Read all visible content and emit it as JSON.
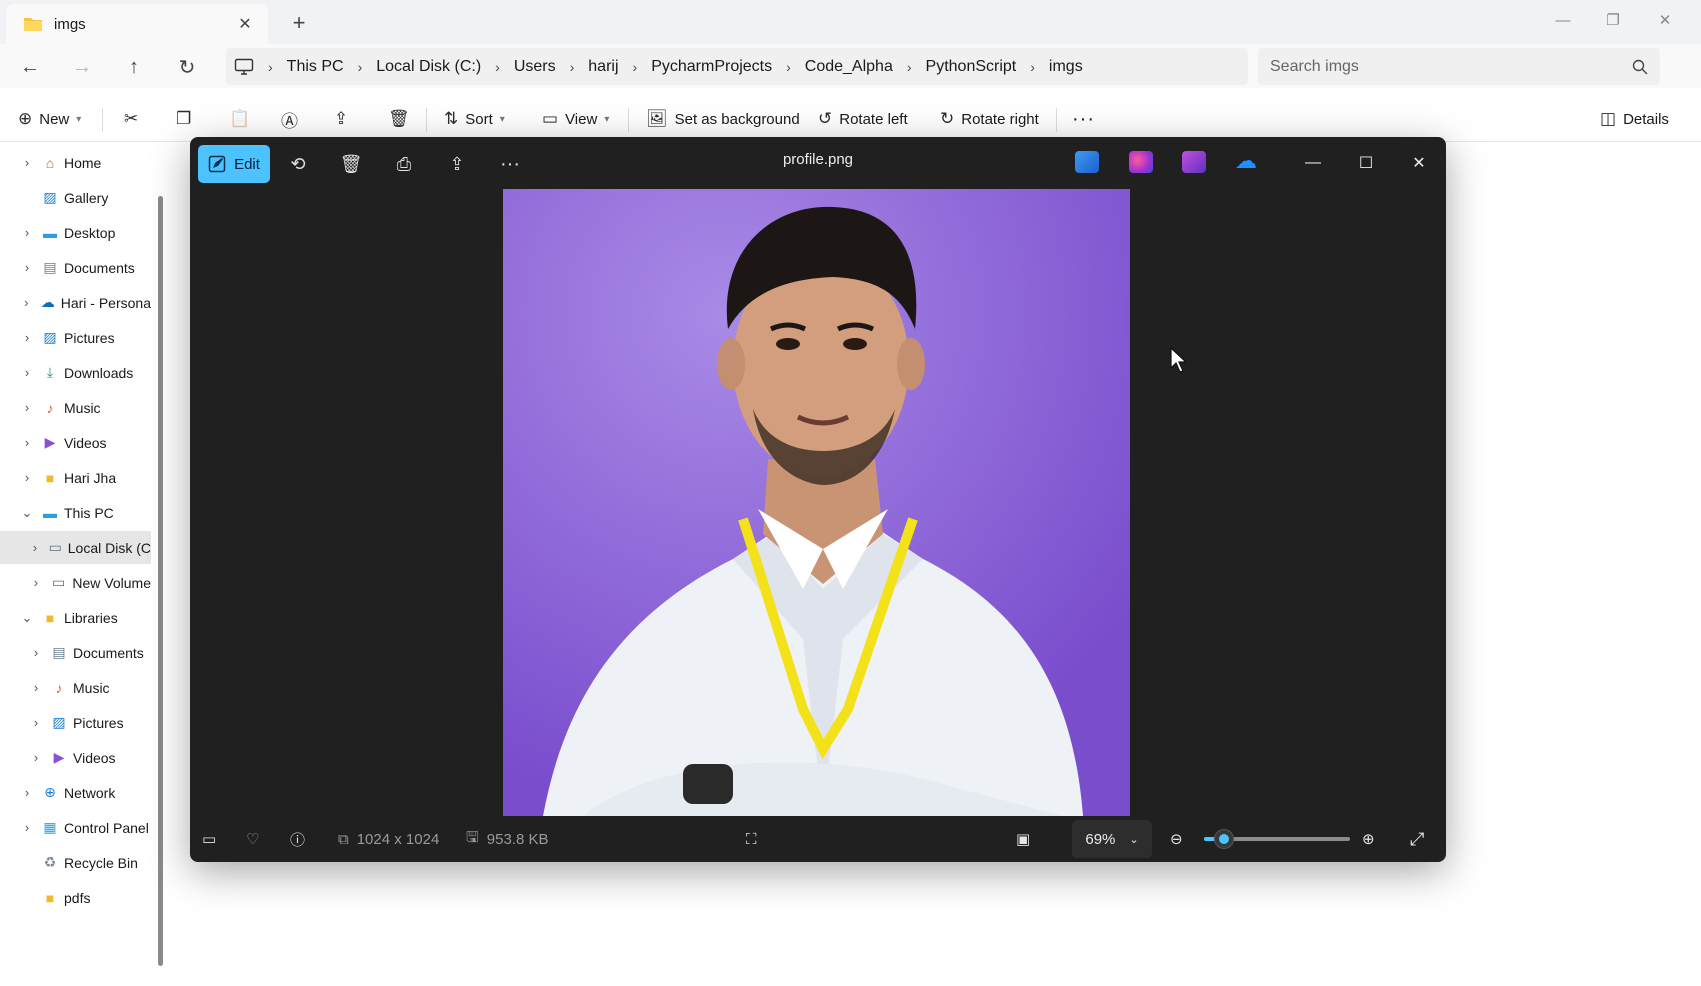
{
  "explorer": {
    "tab": {
      "title": "imgs"
    },
    "breadcrumb": [
      "This PC",
      "Local Disk (C:)",
      "Users",
      "harij",
      "PycharmProjects",
      "Code_Alpha",
      "PythonScript",
      "imgs"
    ],
    "search": {
      "placeholder": "Search imgs"
    },
    "toolbar": {
      "new_label": "New",
      "sort_label": "Sort",
      "view_label": "View",
      "set_background_label": "Set as background",
      "rotate_left_label": "Rotate left",
      "rotate_right_label": "Rotate right",
      "more_label": "···",
      "details_label": "Details"
    },
    "sidebar": {
      "items": [
        {
          "label": "Home",
          "icon": "home-icon"
        },
        {
          "label": "Gallery",
          "icon": "gallery-icon"
        },
        {
          "label": "Desktop",
          "icon": "desktop-icon"
        },
        {
          "label": "Documents",
          "icon": "documents-icon"
        },
        {
          "label": "Hari - Persona",
          "icon": "onedrive-icon"
        },
        {
          "label": "Pictures",
          "icon": "pictures-icon"
        },
        {
          "label": "Downloads",
          "icon": "downloads-icon"
        },
        {
          "label": "Music",
          "icon": "music-icon"
        },
        {
          "label": "Videos",
          "icon": "videos-icon"
        },
        {
          "label": "Hari Jha",
          "icon": "folder-icon"
        },
        {
          "label": "This PC",
          "icon": "this-pc-icon"
        },
        {
          "label": "Local Disk (C",
          "icon": "drive-icon"
        },
        {
          "label": "New Volume",
          "icon": "drive-icon"
        },
        {
          "label": "Libraries",
          "icon": "folder-icon"
        },
        {
          "label": "Documents",
          "icon": "documents-icon"
        },
        {
          "label": "Music",
          "icon": "music-icon"
        },
        {
          "label": "Pictures",
          "icon": "pictures-icon"
        },
        {
          "label": "Videos",
          "icon": "videos-icon"
        },
        {
          "label": "Network",
          "icon": "network-icon"
        },
        {
          "label": "Control Panel",
          "icon": "control-panel-icon"
        },
        {
          "label": "Recycle Bin",
          "icon": "recycle-bin-icon"
        },
        {
          "label": "pdfs",
          "icon": "folder-icon"
        }
      ]
    }
  },
  "viewer": {
    "edit_label": "Edit",
    "filename": "profile.png",
    "dimensions": "1024 x 1024",
    "file_size": "953.8 KB",
    "zoom": "69%",
    "zoom_slider_fraction": 0.14,
    "accent_color": "#4cc2ff"
  }
}
